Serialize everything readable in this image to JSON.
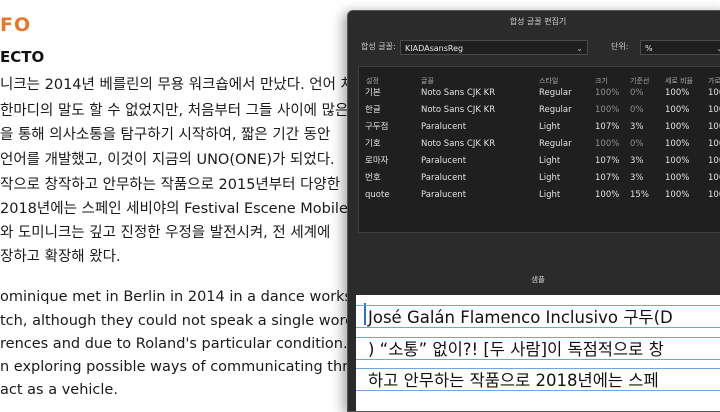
{
  "document": {
    "heading1": "FO",
    "heading2": "ECTO",
    "korean_lines": [
      "니크는 2014년 베를린의 무용 워크숍에서 만났다. 언어 차",
      "한마디의 말도 할 수 없었지만, 처음부터 그들 사이에 많은",
      "을 통해 의사소통을 탐구하기 시작하여, 짧은 기간 동안",
      "언어를 개발했고, 이것이 지금의 UNO(ONE)가 되었다.",
      "작으로 창작하고 안무하는 작품으로 2015년부터 다양한",
      "2018년에는 스페인 세비야의 Festival Escene Mobile에",
      "와 도미니크는 깊고 진정한 우정을 발전시켜, 전 세계에",
      "장하고 확장해 왔다."
    ],
    "english_lines": [
      "ominique met in Berlin in 2014 in a dance workshop",
      "tch, although they could not speak a single word w",
      "rences and due to Roland's particular condition.",
      "n exploring possible ways of communicating throu",
      "act as a vehicle."
    ]
  },
  "dialog": {
    "title": "합성 글꼴 편집기",
    "font_label": "합성 글꼴:",
    "font_value": "KIADAsansReg",
    "unit_label": "단위:",
    "unit_value": "%",
    "columns": [
      "설정",
      "글꼴",
      "스타일",
      "크기",
      "기준선",
      "세로 비율",
      "가로"
    ],
    "rows": [
      {
        "setting": "기본",
        "font": "Noto Sans CJK KR",
        "style": "Regular",
        "size": "100%",
        "baseline": "0%",
        "vscale": "100%",
        "hscale": "100"
      },
      {
        "setting": "한글",
        "font": "Noto Sans CJK KR",
        "style": "Regular",
        "size": "100%",
        "baseline": "0%",
        "vscale": "100%",
        "hscale": "100"
      },
      {
        "setting": "구두점",
        "font": "Paralucent",
        "style": "Light",
        "size": "107%",
        "baseline": "3%",
        "vscale": "100%",
        "hscale": "100"
      },
      {
        "setting": "기호",
        "font": "Noto Sans CJK KR",
        "style": "Regular",
        "size": "100%",
        "baseline": "0%",
        "vscale": "100%",
        "hscale": "100"
      },
      {
        "setting": "로마자",
        "font": "Paralucent",
        "style": "Light",
        "size": "107%",
        "baseline": "3%",
        "vscale": "100%",
        "hscale": "100"
      },
      {
        "setting": "번호",
        "font": "Paralucent",
        "style": "Light",
        "size": "107%",
        "baseline": "3%",
        "vscale": "100%",
        "hscale": "100"
      },
      {
        "setting": "quote",
        "font": "Paralucent",
        "style": "Light",
        "size": "100%",
        "baseline": "15%",
        "vscale": "100%",
        "hscale": "100"
      }
    ],
    "sample_label": "샘플",
    "sample_lines": [
      "José Galán Flamenco Inclusivo 구두(D",
      ") “소통” 없이?! [두 사람]이 독점적으로 창",
      "하고 안무하는 작품으로 2018년에는 스페"
    ]
  }
}
